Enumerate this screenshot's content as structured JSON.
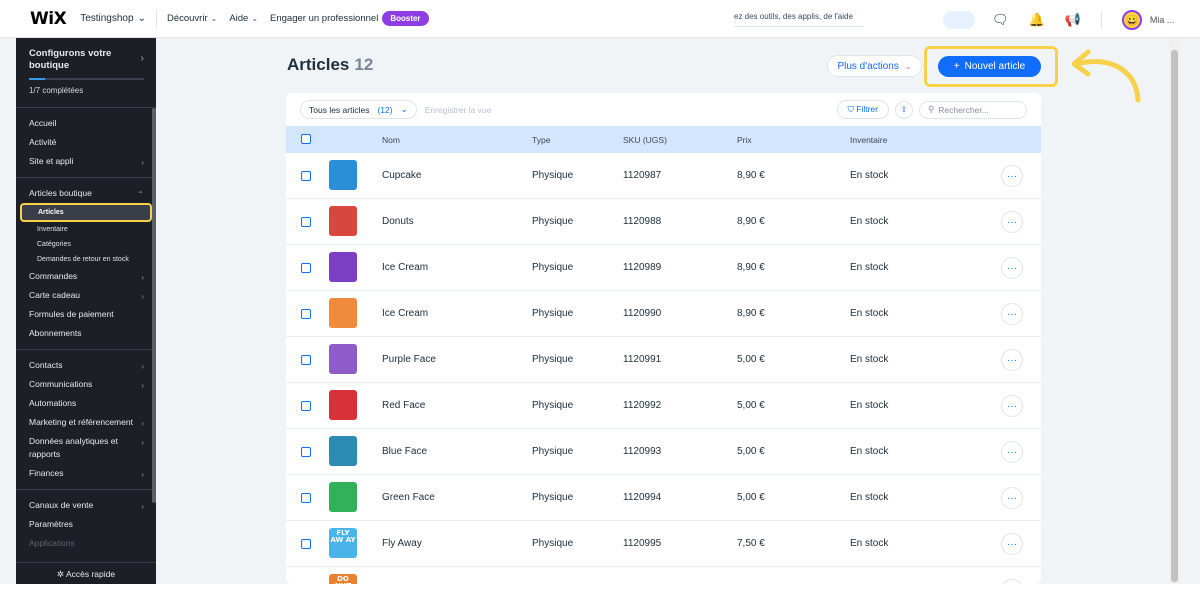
{
  "topbar": {
    "logo": "WiX",
    "site_name": "Testingshop",
    "nav": [
      {
        "label": "Découvrir",
        "has_menu": true
      },
      {
        "label": "Aide",
        "has_menu": true
      },
      {
        "label": "Engager un professionnel",
        "has_menu": false
      }
    ],
    "booster_label": "Booster",
    "search_text": "ez des outils, des applis, de l'aide",
    "user_label": "Mia ..."
  },
  "sidebar": {
    "setup_title": "Configurons votre boutique",
    "progress_label": "1/7 complétées",
    "progress_fraction": 0.143,
    "group1": [
      {
        "label": "Accueil",
        "arrow": false
      },
      {
        "label": "Activité",
        "arrow": false
      },
      {
        "label": "Site et appli",
        "arrow": true
      }
    ],
    "store_section": "Articles boutique",
    "store_subs": [
      "Articles",
      "Inventaire",
      "Catégories",
      "Demandes de retour en stock"
    ],
    "group2": [
      {
        "label": "Commandes",
        "arrow": true
      },
      {
        "label": "Carte cadeau",
        "arrow": true
      },
      {
        "label": "Formules de paiement",
        "arrow": false
      },
      {
        "label": "Abonnements",
        "arrow": false
      }
    ],
    "group3": [
      {
        "label": "Contacts",
        "arrow": true
      },
      {
        "label": "Communications",
        "arrow": true
      },
      {
        "label": "Automations",
        "arrow": false
      },
      {
        "label": "Marketing et référencement",
        "arrow": true
      },
      {
        "label": "Données analytiques et rapports",
        "arrow": true
      },
      {
        "label": "Finances",
        "arrow": true
      }
    ],
    "group4": [
      {
        "label": "Canaux de vente",
        "arrow": true
      },
      {
        "label": "Paramètres",
        "arrow": false
      },
      {
        "label": "Applications",
        "arrow": false
      }
    ],
    "quick_access": "Accès rapide"
  },
  "page": {
    "title": "Articles",
    "count": "12",
    "more_actions": "Plus d'actions",
    "new_item": "Nouvel article"
  },
  "toolbar": {
    "view_label": "Tous les articles",
    "view_count": "(12)",
    "save_view": "Enregistrer la vue",
    "filter": "Filtrer",
    "search_placeholder": "Rechercher..."
  },
  "table": {
    "columns": [
      "Nom",
      "Type",
      "SKU (UGS)",
      "Prix",
      "Inventaire"
    ],
    "rows": [
      {
        "name": "Cupcake",
        "type": "Physique",
        "sku": "1120987",
        "price": "8,90 €",
        "stock": "En stock",
        "thumb_color": "#2a8fd6"
      },
      {
        "name": "Donuts",
        "type": "Physique",
        "sku": "1120988",
        "price": "8,90 €",
        "stock": "En stock",
        "thumb_color": "#d9463e"
      },
      {
        "name": "Ice Cream",
        "type": "Physique",
        "sku": "1120989",
        "price": "8,90 €",
        "stock": "En stock",
        "thumb_color": "#7b3fc4"
      },
      {
        "name": "Ice Cream",
        "type": "Physique",
        "sku": "1120990",
        "price": "8,90 €",
        "stock": "En stock",
        "thumb_color": "#f08a3c"
      },
      {
        "name": "Purple Face",
        "type": "Physique",
        "sku": "1120991",
        "price": "5,00 €",
        "stock": "En stock",
        "thumb_color": "#8d5cc8"
      },
      {
        "name": "Red Face",
        "type": "Physique",
        "sku": "1120992",
        "price": "5,00 €",
        "stock": "En stock",
        "thumb_color": "#d9313a"
      },
      {
        "name": "Blue Face",
        "type": "Physique",
        "sku": "1120993",
        "price": "5,00 €",
        "stock": "En stock",
        "thumb_color": "#2d8bb3"
      },
      {
        "name": "Green Face",
        "type": "Physique",
        "sku": "1120994",
        "price": "5,00 €",
        "stock": "En stock",
        "thumb_color": "#33b05a"
      },
      {
        "name": "Fly Away",
        "type": "Physique",
        "sku": "1120995",
        "price": "7,50 €",
        "stock": "En stock",
        "thumb_color": "#4ab3e8",
        "thumb_text": "FLY AW AY"
      },
      {
        "name": "",
        "type": "",
        "sku": "",
        "price": "",
        "stock": "",
        "thumb_color": "#e9822e",
        "thumb_text": "DO NUT"
      }
    ]
  },
  "colors": {
    "accent": "#116dff",
    "highlight": "#f8d14a",
    "sidebar_bg": "#1d1f26",
    "header_row": "#d3e6fd"
  }
}
